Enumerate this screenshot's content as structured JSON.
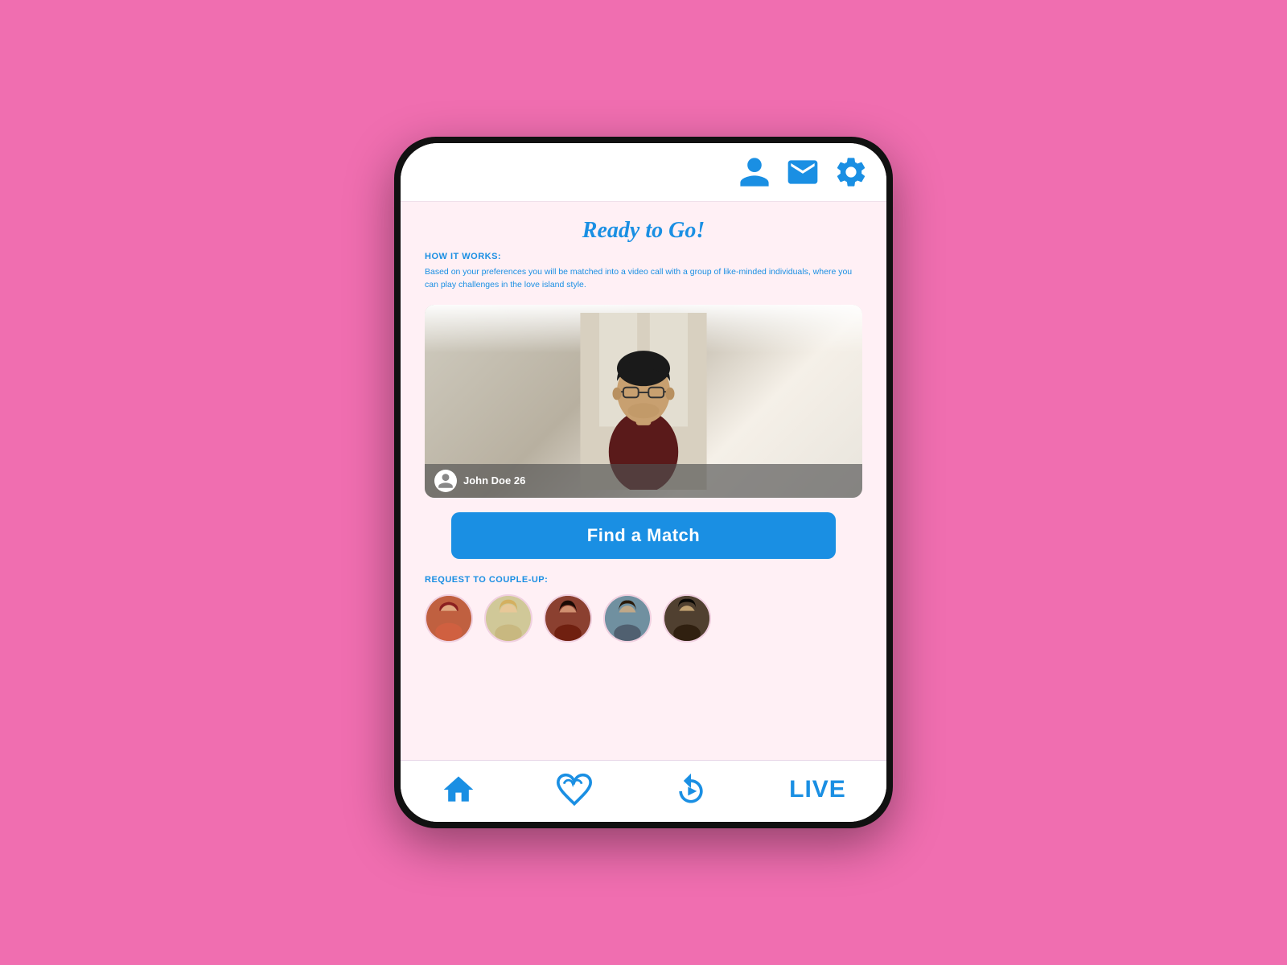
{
  "app": {
    "background_color": "#f06eb0",
    "title": "Ready to Go!",
    "header": {
      "icons": [
        "profile-icon",
        "message-icon",
        "settings-icon"
      ]
    },
    "how_it_works": {
      "label": "HOW IT WORKS:",
      "description": "Based on your preferences you will be matched into a video call with a group of like-minded individuals, where you can play challenges in the love island style."
    },
    "profile": {
      "name": "John Doe  26"
    },
    "find_match_button": "Find a Match",
    "couple_up": {
      "label": "REQUEST TO COUPLE-UP:",
      "avatars": [
        {
          "id": 1,
          "emoji": "👩",
          "bg": "#c87050"
        },
        {
          "id": 2,
          "emoji": "👱‍♀️",
          "bg": "#d4c8b0"
        },
        {
          "id": 3,
          "emoji": "👩‍🦱",
          "bg": "#8B6050"
        },
        {
          "id": 4,
          "emoji": "👩",
          "bg": "#7090a0"
        },
        {
          "id": 5,
          "emoji": "👩‍🦫",
          "bg": "#503020"
        }
      ]
    },
    "bottom_nav": {
      "items": [
        {
          "id": "home",
          "label": "Home"
        },
        {
          "id": "match",
          "label": "Match"
        },
        {
          "id": "replay",
          "label": "Replay"
        },
        {
          "id": "live",
          "label": "LIVE"
        }
      ]
    }
  }
}
